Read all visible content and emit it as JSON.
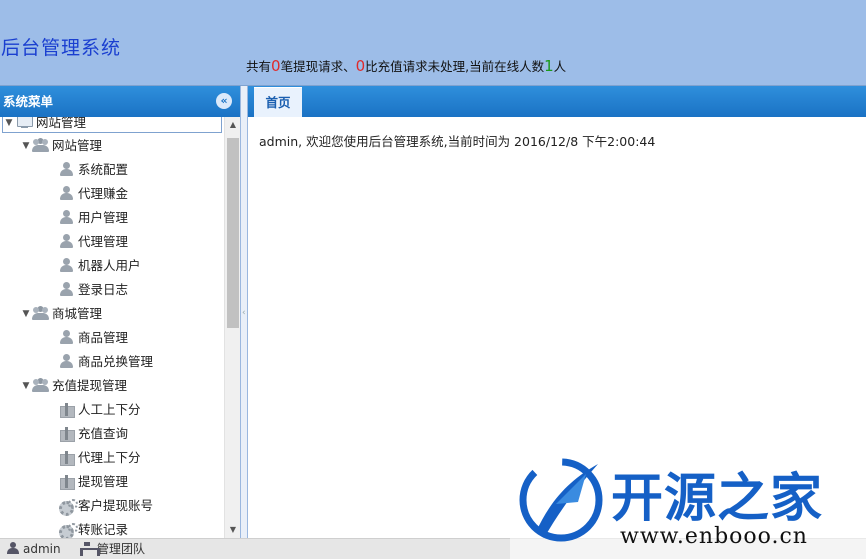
{
  "header": {
    "app_title": "后台管理系统",
    "notice": {
      "prefix": "共有",
      "withdraw_count": "0",
      "withdraw_text": "笔提现请求、",
      "recharge_count": "0",
      "recharge_text": "比充值请求未处理,当前在线人数",
      "online_count": "1",
      "online_suffix": "人"
    }
  },
  "sidebar": {
    "title": "系统菜单",
    "collapse_icon": "double-chevron-left-icon",
    "root": {
      "label": "网站管理",
      "icon": "monitor-icon"
    },
    "groups": [
      {
        "label": "网站管理",
        "icon": "user-group-icon",
        "items": [
          {
            "label": "系统配置",
            "icon": "user-icon"
          },
          {
            "label": "代理赚金",
            "icon": "user-icon"
          },
          {
            "label": "用户管理",
            "icon": "user-icon"
          },
          {
            "label": "代理管理",
            "icon": "user-icon"
          },
          {
            "label": "机器人用户",
            "icon": "user-icon"
          },
          {
            "label": "登录日志",
            "icon": "user-icon"
          }
        ]
      },
      {
        "label": "商城管理",
        "icon": "user-group-icon",
        "items": [
          {
            "label": "商品管理",
            "icon": "user-icon"
          },
          {
            "label": "商品兑换管理",
            "icon": "user-icon"
          }
        ]
      },
      {
        "label": "充值提现管理",
        "icon": "user-group-icon",
        "items": [
          {
            "label": "人工上下分",
            "icon": "gift-icon"
          },
          {
            "label": "充值查询",
            "icon": "gift-icon"
          },
          {
            "label": "代理上下分",
            "icon": "gift-icon"
          },
          {
            "label": "提现管理",
            "icon": "gift-icon"
          },
          {
            "label": "客户提现账号",
            "icon": "gears-icon"
          },
          {
            "label": "转账记录",
            "icon": "gears-icon"
          }
        ]
      }
    ]
  },
  "main": {
    "tabs": [
      {
        "label": "首页"
      }
    ],
    "welcome": "admin, 欢迎您使用后台管理系统,当前时间为 2016/12/8 下午2:00:44"
  },
  "footer": {
    "user": "admin",
    "team": "管理团队"
  },
  "watermark": {
    "brand": "开源之家",
    "url": "www.enbooo.cn"
  },
  "colors": {
    "header_bg": "#9dbde8",
    "title_blue": "#1a3fd0",
    "bar_blue": "#1a72c4",
    "count_red": "#e02a2a",
    "count_green": "#1a9a1a"
  }
}
